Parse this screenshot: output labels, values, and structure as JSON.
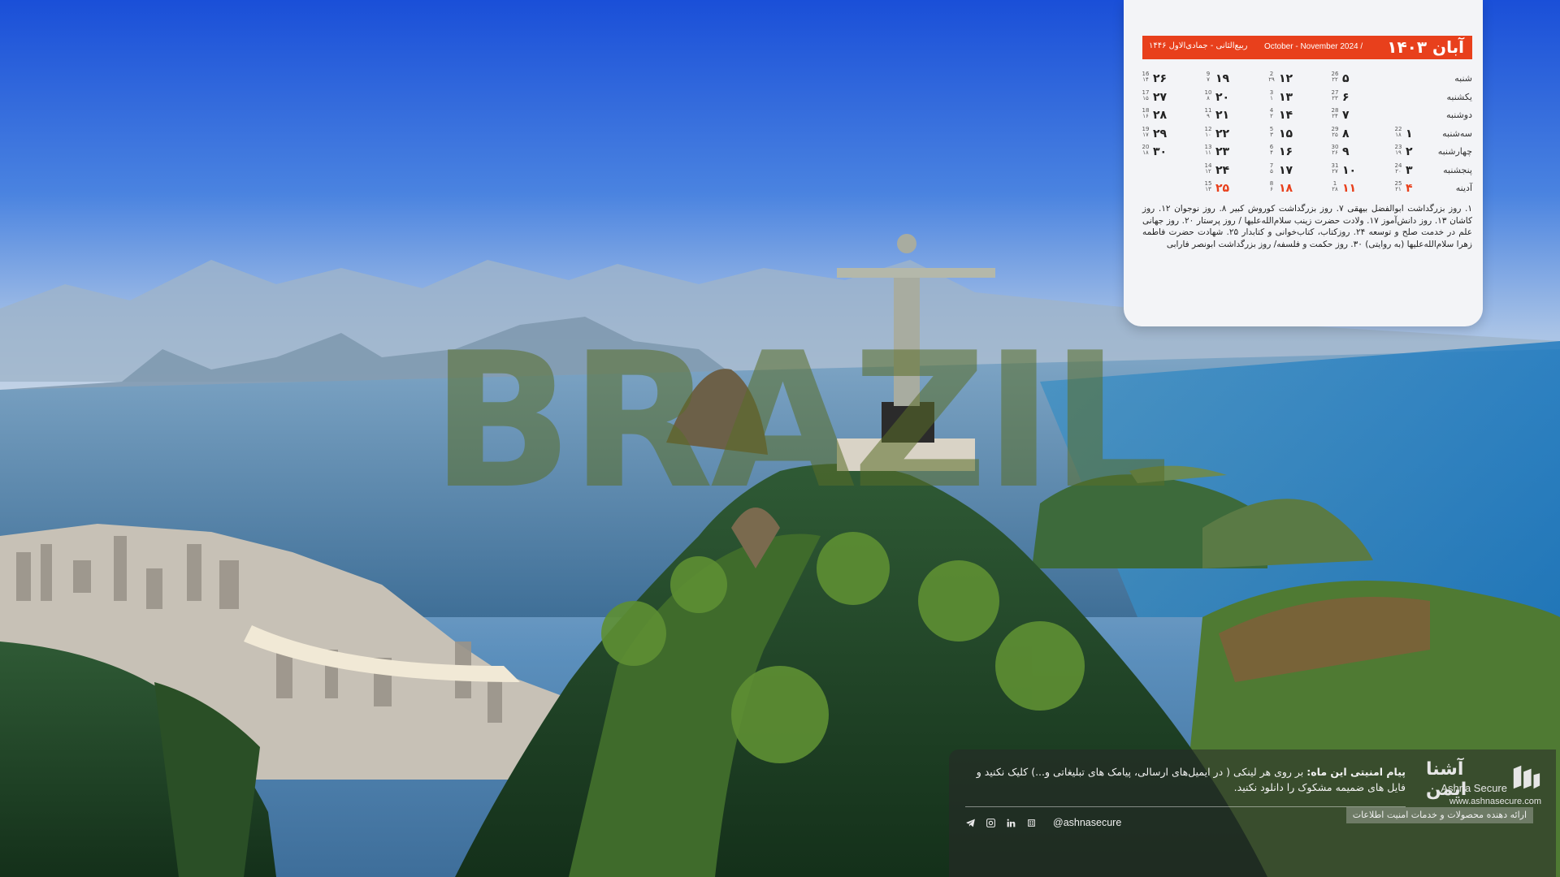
{
  "watermark": "BRAZIL",
  "calendar": {
    "month_title": "آبان ۱۴۰۳",
    "gregorian_range": "October - November 2024 /",
    "hijri_range": "ربیع‌الثانی - جمادی‌الاول ۱۴۴۶",
    "weekdays": [
      "شنبه",
      "یکشنبه",
      "دوشنبه",
      "سه‌شنبه",
      "چهارشنبه",
      "پنجشنبه",
      "آدینه"
    ],
    "columns": [
      [
        {
          "num": "",
          "g": "",
          "h": ""
        },
        {
          "num": "",
          "g": "",
          "h": ""
        },
        {
          "num": "",
          "g": "",
          "h": ""
        },
        {
          "num": "۱",
          "g": "22",
          "h": "۱۸"
        },
        {
          "num": "۲",
          "g": "23",
          "h": "۱۹"
        },
        {
          "num": "۳",
          "g": "24",
          "h": "۲۰"
        },
        {
          "num": "۴",
          "g": "25",
          "h": "۲۱",
          "holiday": true
        }
      ],
      [
        {
          "num": "۵",
          "g": "26",
          "h": "۲۲"
        },
        {
          "num": "۶",
          "g": "27",
          "h": "۲۳"
        },
        {
          "num": "۷",
          "g": "28",
          "h": "۲۴"
        },
        {
          "num": "۸",
          "g": "29",
          "h": "۲۵"
        },
        {
          "num": "۹",
          "g": "30",
          "h": "۲۶"
        },
        {
          "num": "۱۰",
          "g": "31",
          "h": "۲۷"
        },
        {
          "num": "۱۱",
          "g": "1",
          "h": "۲۸",
          "holiday": true
        }
      ],
      [
        {
          "num": "۱۲",
          "g": "2",
          "h": "۲۹"
        },
        {
          "num": "۱۳",
          "g": "3",
          "h": "۱"
        },
        {
          "num": "۱۴",
          "g": "4",
          "h": "۲"
        },
        {
          "num": "۱۵",
          "g": "5",
          "h": "۳"
        },
        {
          "num": "۱۶",
          "g": "6",
          "h": "۴"
        },
        {
          "num": "۱۷",
          "g": "7",
          "h": "۵"
        },
        {
          "num": "۱۸",
          "g": "8",
          "h": "۶",
          "holiday": true
        }
      ],
      [
        {
          "num": "۱۹",
          "g": "9",
          "h": "۷"
        },
        {
          "num": "۲۰",
          "g": "10",
          "h": "۸"
        },
        {
          "num": "۲۱",
          "g": "11",
          "h": "۹"
        },
        {
          "num": "۲۲",
          "g": "12",
          "h": "۱۰"
        },
        {
          "num": "۲۳",
          "g": "13",
          "h": "۱۱"
        },
        {
          "num": "۲۴",
          "g": "14",
          "h": "۱۲"
        },
        {
          "num": "۲۵",
          "g": "15",
          "h": "۱۳",
          "holiday": true
        }
      ],
      [
        {
          "num": "۲۶",
          "g": "16",
          "h": "۱۴"
        },
        {
          "num": "۲۷",
          "g": "17",
          "h": "۱۵"
        },
        {
          "num": "۲۸",
          "g": "18",
          "h": "۱۶"
        },
        {
          "num": "۲۹",
          "g": "19",
          "h": "۱۷"
        },
        {
          "num": "۳۰",
          "g": "20",
          "h": "۱۸"
        },
        {
          "num": "",
          "g": "",
          "h": ""
        },
        {
          "num": "",
          "g": "",
          "h": ""
        }
      ]
    ],
    "events": "۱. روز بزرگداشت ابوالفضل بیهقی ۷. روز بزرگداشت کوروش کبیر ۸. روز نوجوان ۱۲. روز کاشان ۱۳. روز دانش‌آموز ۱۷. ولادت حضرت زینب سلام‌الله‌علیها / روز پرستار ۲۰. روز جهانی علم در خدمت صلح و توسعه ۲۴. روزکتاب، کتاب‌خوانی و کتابدار ۲۵. شهادت حضرت فاطمه زهرا سلام‌الله‌علیها (به روایتی) ۳۰. روز حکمت و فلسفه/ روز بزرگداشت ابونصر فارابی"
  },
  "footer": {
    "brand_fa": "آشنا ایمن",
    "brand_en": "Ashna Secure",
    "brand_url": "www.ashnasecure.com",
    "brand_tagline": "ارائه دهنده محصولات و خدمات امنیت اطلاعات",
    "message_title": "پیام امنیتی این ماه:",
    "message_body": " بر روی هر لینکی ( در ایمیل‌های ارسالی، پیامک های تبلیغاتی و...) کلیک نکنید و فایل های ضمیمه مشکوک را دانلود نکنید.",
    "social_handle": "@ashnasecure",
    "social_icons": [
      "telegram-icon",
      "instagram-icon",
      "linkedin-icon",
      "aparat-icon"
    ]
  },
  "colors": {
    "accent": "#e8401c",
    "card_bg": "#f3f4f7"
  }
}
